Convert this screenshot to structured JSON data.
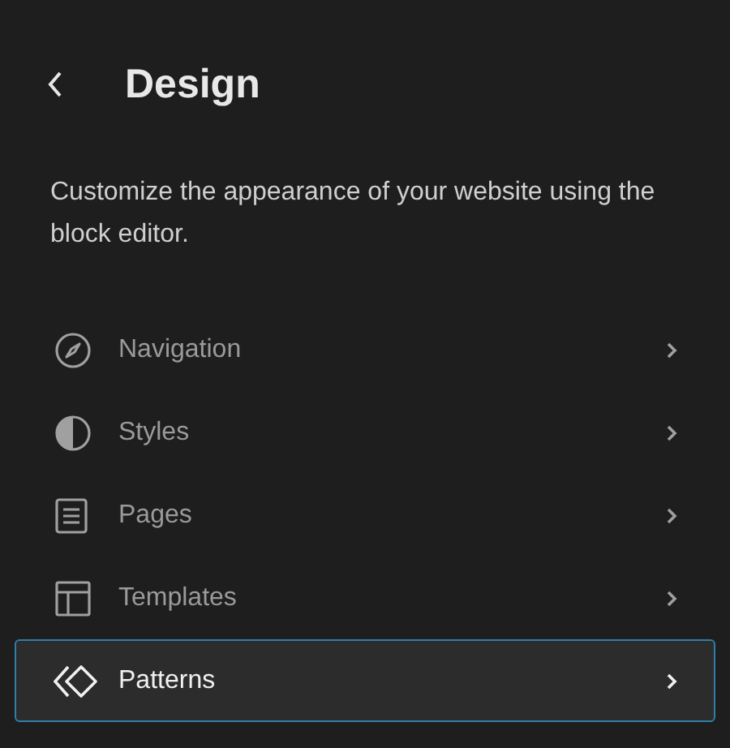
{
  "header": {
    "title": "Design",
    "description": "Customize the appearance of your website using the block editor."
  },
  "menu": [
    {
      "kind": "navigation",
      "label": "Navigation",
      "selected": false
    },
    {
      "kind": "styles",
      "label": "Styles",
      "selected": false
    },
    {
      "kind": "pages",
      "label": "Pages",
      "selected": false
    },
    {
      "kind": "templates",
      "label": "Templates",
      "selected": false
    },
    {
      "kind": "patterns",
      "label": "Patterns",
      "selected": true
    }
  ]
}
